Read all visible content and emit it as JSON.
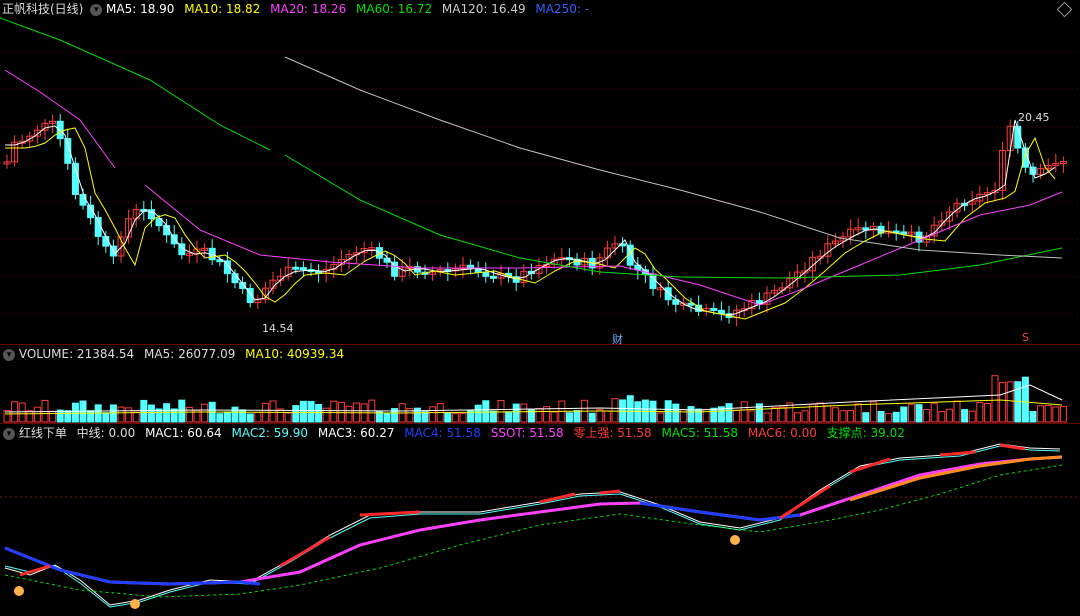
{
  "main_panel": {
    "title": "正帆科技(日线)",
    "ma5": "MA5: 18.90",
    "ma10": "MA10: 18.82",
    "ma20": "MA20: 18.26",
    "ma60": "MA60: 16.72",
    "ma120": "MA120: 16.49",
    "ma250": "MA250: -",
    "low_label": "14.54",
    "high_label": "20.45",
    "cai_marker": "财",
    "s_marker": "S"
  },
  "volume_panel": {
    "volume": "VOLUME: 21384.54",
    "ma5": "MA5: 26077.09",
    "ma10": "MA10: 40939.34"
  },
  "indicator_panel": {
    "name": "红线下单",
    "mid": "中线: 0.00",
    "mac1": "MAC1: 60.64",
    "mac2": "MAC2: 59.90",
    "mac3": "MAC3: 60.27",
    "mac4": "MAC4: 51.58",
    "mac_hidden": "SSOT: 51.58",
    "zero_up": "零上强: 51.58",
    "mac5": "MAC5: 51.58",
    "mac6": "MAC6: 0.00",
    "support": "支撑点: 39.02"
  },
  "colors": {
    "up": "#ff3b3b",
    "down": "#54ffff",
    "ma5": "#ffffff",
    "ma10": "#ffff00",
    "ma20": "#ff40ff",
    "ma60": "#00e000",
    "ma120": "#c0c0c0",
    "ma250": "#3060ff"
  }
}
